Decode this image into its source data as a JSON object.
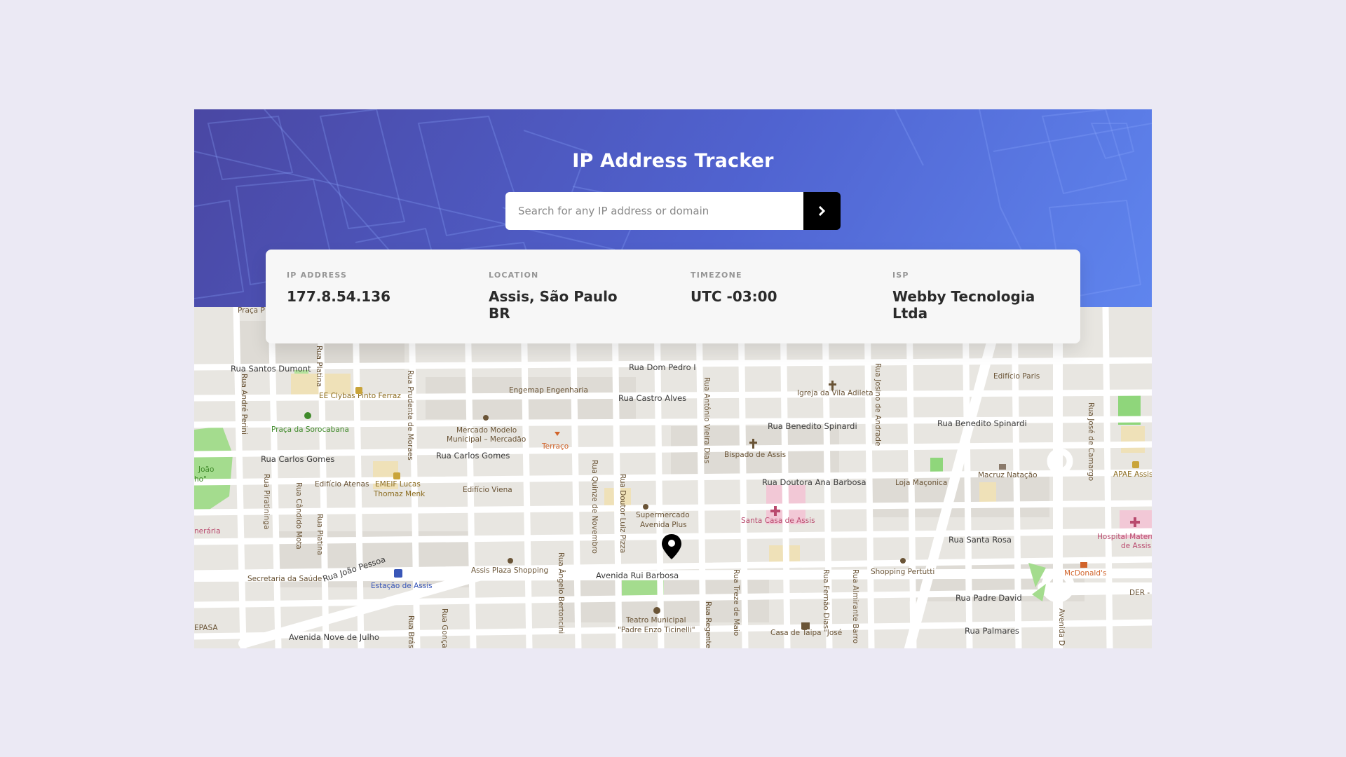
{
  "header": {
    "title": "IP Address Tracker",
    "search_placeholder": "Search for any IP address or domain",
    "search_value": ""
  },
  "info": {
    "ip_label": "IP ADDRESS",
    "ip_value": "177.8.54.136",
    "location_label": "LOCATION",
    "location_value": "Assis, São Paulo",
    "location_country": "BR",
    "timezone_label": "TIMEZONE",
    "timezone_value": "UTC -03:00",
    "isp_label": "ISP",
    "isp_value": "Webby Tecnologia Ltda"
  },
  "icons": {
    "search_submit": "chevron-right-icon",
    "map_marker": "location-pin-icon"
  },
  "colors": {
    "background": "#ebe9f4",
    "header_start": "#4a47a3",
    "header_end": "#5f85ee",
    "button": "#000000"
  },
  "map": {
    "streets": {
      "santos_dumont": "Rua Santos Dumont",
      "dom_pedro": "Rua Dom Pedro I",
      "castro_alves": "Rua Castro Alves",
      "benedito_spinardi_1": "Rua Benedito Spinardi",
      "benedito_spinardi_2": "Rua Benedito Spinardi",
      "carlos_gomes_1": "Rua Carlos Gomes",
      "carlos_gomes_2": "Rua Carlos Gomes",
      "doutora_ana": "Rua Doutora Ana Barbosa",
      "santa_rosa": "Rua Santa Rosa",
      "rui_barbosa": "Avenida Rui Barbosa",
      "padre_david": "Rua Padre David",
      "palmares": "Rua Palmares",
      "nove_julho": "Avenida Nove de Julho",
      "joao_pessoa": "Rua João Pessoa",
      "andre_perini": "Rua André Perini",
      "platina_1": "Rua Platina",
      "platina_2": "Rua Platina",
      "prudente": "Rua Prudente de Moraes",
      "quinze": "Rua Quinze de Novembro",
      "luiz_pizza": "Rua Doutor Luiz Pizza",
      "antonio_vieira": "Rua Antônio Vieira Dias",
      "josino": "Rua Josino de Andrade",
      "jose_camargo": "Rua José de Camargo",
      "piratininga": "Rua Piratininga",
      "candido_mota": "Rua Cândido Mota",
      "angelo": "Rua Ângelo Bertoncini",
      "regente": "Rua Regente",
      "treze_maio": "Rua Treze de Maio",
      "fernao_dias": "Rua Fernão Dias",
      "almirante": "Rua Almirante Barro",
      "bras": "Rua Brás",
      "goncalves": "Rua Gonçal",
      "avenida_d": "Avenida D",
      "praca_p": "Praça P"
    },
    "pois": {
      "clybas": "EE Clybas Pinto Ferraz",
      "sorocabana": "Praça da Sorocabana",
      "engemap": "Engemap Engenharia",
      "mercado_1": "Mercado Modelo",
      "mercado_2": "Municipal – Mercadão",
      "terraco": "Terraço",
      "igreja": "Igreja da Vila Adileta",
      "edificio_paris": "Edifício Paris",
      "bispado": "Bispado de Assis",
      "edificio_atenas": "Edifício Atenas",
      "emeif_1": "EMEIF Lucas",
      "emeif_2": "Thomaz Menk",
      "edificio_viena": "Edifício Viena",
      "supermercado_1": "Supermercado",
      "supermercado_2": "Avenida Plus",
      "santa_casa": "Santa Casa de Assis",
      "loja": "Loja Maçonica",
      "macruz": "Macruz Natação",
      "apae": "APAE Assis",
      "hospital_1": "Hospital Matern",
      "hospital_2": "de Assis",
      "assis_plaza": "Assis Plaza Shopping",
      "estacao": "Estação de Assis",
      "secretaria": "Secretaria da Saúde",
      "shopping_pertutti": "Shopping Pertutti",
      "mcdonalds": "McDonald's",
      "teatro_1": "Teatro Municipal",
      "teatro_2": "\"Padre Enzo Ticinelli\"",
      "casa_taipa": "Casa de Taipa \"José",
      "der": "DER -",
      "epasa": "EPASA",
      "funeraria": "nerária",
      "joao_1": "João",
      "joao_2": "ho\""
    }
  }
}
